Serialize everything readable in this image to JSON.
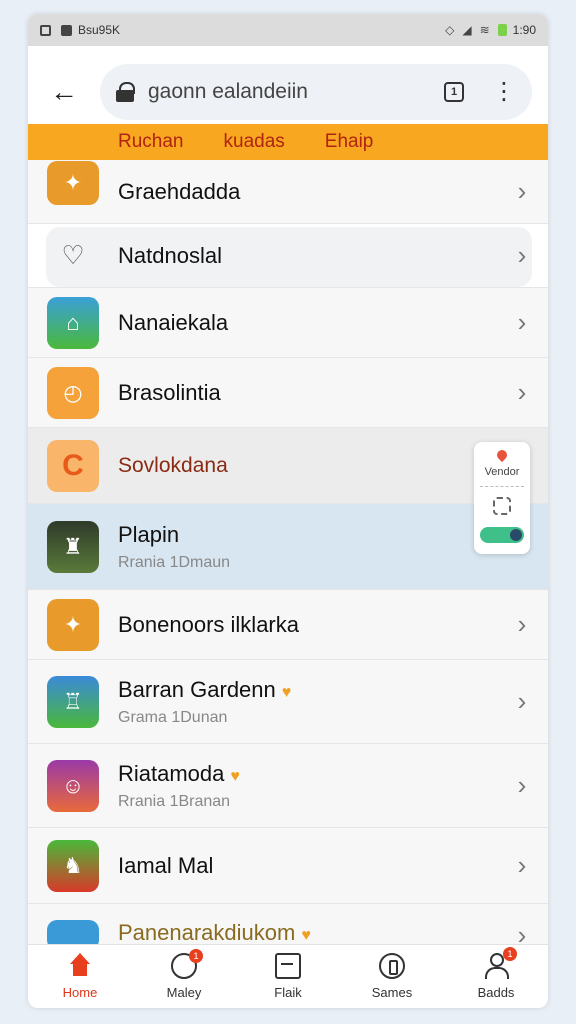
{
  "status_bar": {
    "carrier": "Bsu95K",
    "time": "1:90"
  },
  "url_bar": {
    "url": "gaonn ealandeiin"
  },
  "tabs": [
    "Ruchan",
    "kuadas",
    "Ehaip"
  ],
  "list": [
    {
      "title": "Graehdadda",
      "subtitle": "",
      "icon": "game-yellow-icon",
      "color": "#e89b2a"
    },
    {
      "title": "Natdnoslal",
      "subtitle": "",
      "icon": "chat-bubble-icon",
      "color": "#ffffff"
    },
    {
      "title": "Nanaiekala",
      "subtitle": "",
      "icon": "game-green-icon",
      "color": "#3aa0d8"
    },
    {
      "title": "Brasolintia",
      "subtitle": "",
      "icon": "clock-orange-icon",
      "color": "#f5a23a"
    },
    {
      "title": "Sovlokdana",
      "subtitle": "",
      "icon": "orange-c-icon",
      "color": "#f59a3a"
    },
    {
      "title": "Plapin",
      "subtitle": "Rrania 1Dmaun",
      "icon": "statue-game-icon",
      "color": "#2f3a2a"
    },
    {
      "title": "Bonenoors ilklarka",
      "subtitle": "",
      "icon": "game-yellow-icon",
      "color": "#e89b2a"
    },
    {
      "title": "Barran Gardenn",
      "subtitle": "Grama 1Dunan",
      "icon": "tower-game-icon",
      "color": "#3a8ad8"
    },
    {
      "title": "Riatamoda",
      "subtitle": "Rrania 1Branan",
      "icon": "character-game-icon",
      "color": "#9a3aa8"
    },
    {
      "title": "Iamal Mal",
      "subtitle": "",
      "icon": "red-robot-game-icon",
      "color": "#4ab83a"
    },
    {
      "title": "Panenarakdiukom",
      "subtitle": "",
      "icon": "blue-game-icon",
      "color": "#3a9ad8"
    }
  ],
  "floating_widget": {
    "label": "Vendor"
  },
  "bottom_nav": [
    {
      "label": "Home",
      "icon": "home-icon",
      "badge": ""
    },
    {
      "label": "Maley",
      "icon": "message-icon",
      "badge": "1"
    },
    {
      "label": "Flaik",
      "icon": "document-icon",
      "badge": ""
    },
    {
      "label": "Sames",
      "icon": "games-icon",
      "badge": ""
    },
    {
      "label": "Badds",
      "icon": "user-icon",
      "badge": "1"
    }
  ],
  "colors": {
    "accent": "#f7a720",
    "active": "#e8401f",
    "highlight_row": "#d8e6f1"
  }
}
